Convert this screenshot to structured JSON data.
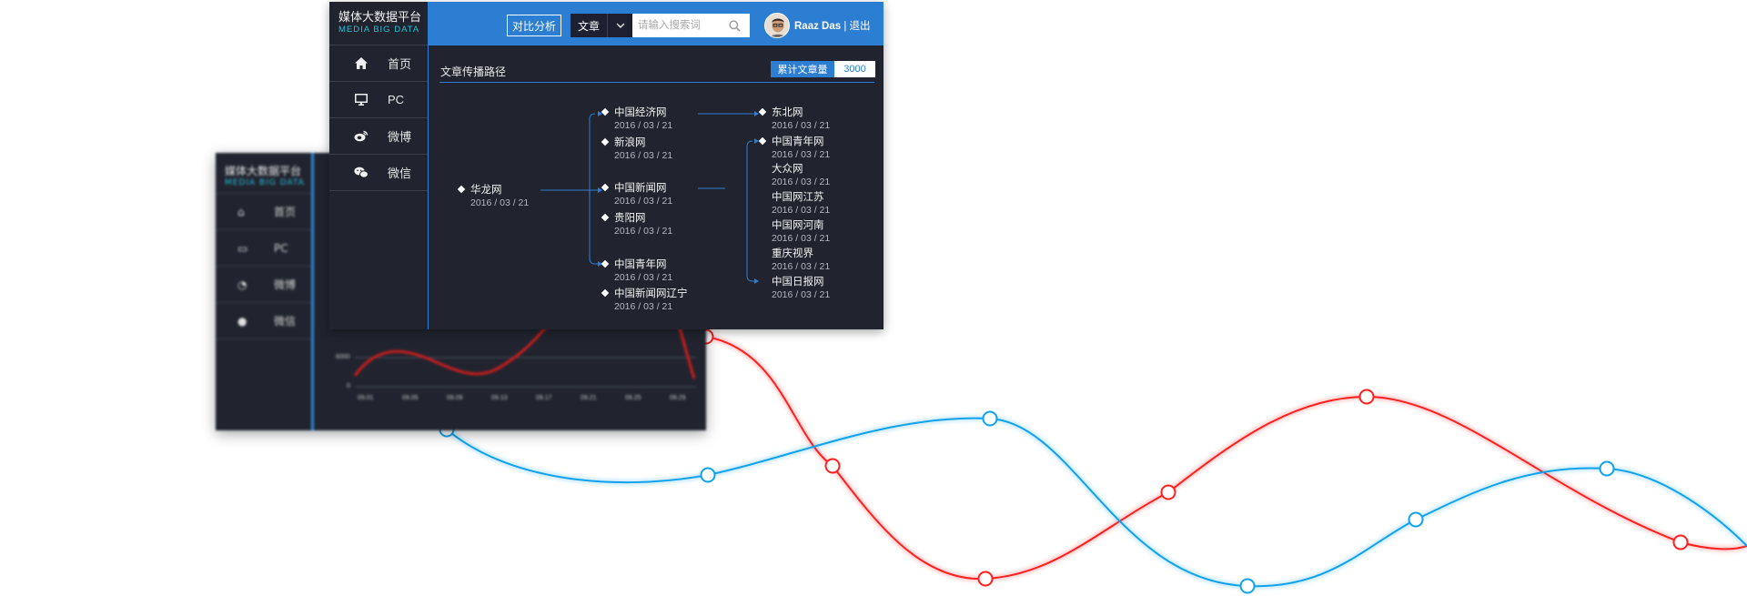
{
  "back_window": {
    "brand_title": "媒体大数据平台",
    "brand_subtitle": "MEDIA BIG DATA",
    "nav": [
      {
        "label": "首页",
        "icon": "home-icon"
      },
      {
        "label": "PC",
        "icon": "monitor-icon"
      },
      {
        "label": "微博",
        "icon": "weibo-icon"
      },
      {
        "label": "微信",
        "icon": "wechat-icon"
      }
    ],
    "chart": {
      "y_ticks": [
        "6000",
        "0"
      ],
      "x_ticks": [
        "09.01",
        "09.05",
        "09.09",
        "09.13",
        "09.17",
        "09.21",
        "09.25",
        "09.29"
      ]
    }
  },
  "window": {
    "brand_title": "媒体大数据平台",
    "brand_subtitle": "MEDIA BIG DATA",
    "nav": [
      {
        "label": "首页",
        "icon": "home-icon"
      },
      {
        "label": "PC",
        "icon": "monitor-icon"
      },
      {
        "label": "微博",
        "icon": "weibo-icon"
      },
      {
        "label": "微信",
        "icon": "wechat-icon"
      }
    ],
    "header": {
      "compare_label": "对比分析",
      "search_type": "文章",
      "search_placeholder": "请输入搜索词",
      "user_name": "Raaz Das",
      "logout_label": " | 退出"
    },
    "panel": {
      "title": "文章传播路径",
      "count_label": "累计文章量",
      "count_value": "3000"
    },
    "tree": {
      "root": {
        "name": "华龙网",
        "date": "2016 / 03 / 21"
      },
      "level1": [
        {
          "name": "中国经济网",
          "date": "2016 / 03 / 21"
        },
        {
          "name": "新浪网",
          "date": "2016 / 03 / 21"
        },
        {
          "name": "中国新闻网",
          "date": "2016 / 03 / 21"
        },
        {
          "name": "贵阳网",
          "date": "2016 / 03 / 21"
        },
        {
          "name": "中国青年网",
          "date": "2016 / 03 / 21"
        },
        {
          "name": "中国新闻网辽宁",
          "date": "2016 / 03 / 21"
        }
      ],
      "level2": [
        {
          "name": "东北网",
          "date": "2016 / 03 / 21"
        },
        {
          "name": "中国青年网",
          "date": "2016 / 03 / 21"
        },
        {
          "name": "大众网",
          "date": "2016 / 03 / 21"
        },
        {
          "name": "中国网江苏",
          "date": "2016 / 03 / 21"
        },
        {
          "name": "中国网河南",
          "date": "2016 / 03 / 21"
        },
        {
          "name": "重庆视界",
          "date": "2016 / 03 / 21"
        },
        {
          "name": "中国日报网",
          "date": "2016 / 03 / 21"
        }
      ]
    }
  },
  "colors": {
    "accent": "#2c7ed3",
    "panel_bg": "#21242f",
    "brand_subtitle": "#24c0da",
    "red_curve": "#ff1f1f",
    "blue_curve": "#10a2ea"
  }
}
